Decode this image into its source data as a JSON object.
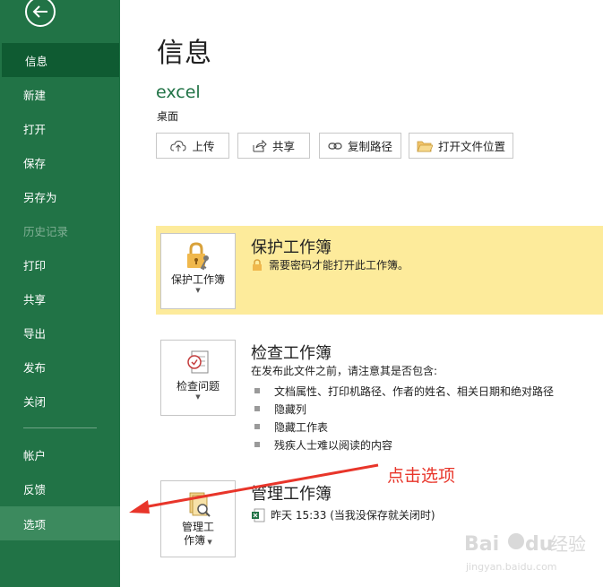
{
  "sidebar": {
    "back_icon": "arrow-left-icon",
    "items": [
      {
        "label": "信息",
        "state": "active"
      },
      {
        "label": "新建",
        "state": "normal"
      },
      {
        "label": "打开",
        "state": "normal"
      },
      {
        "label": "保存",
        "state": "normal"
      },
      {
        "label": "另存为",
        "state": "normal"
      },
      {
        "label": "历史记录",
        "state": "disabled"
      },
      {
        "label": "打印",
        "state": "normal"
      },
      {
        "label": "共享",
        "state": "normal"
      },
      {
        "label": "导出",
        "state": "normal"
      },
      {
        "label": "发布",
        "state": "normal"
      },
      {
        "label": "关闭",
        "state": "normal"
      },
      {
        "label": "帐户",
        "state": "normal"
      },
      {
        "label": "反馈",
        "state": "normal"
      },
      {
        "label": "选项",
        "state": "hover"
      }
    ]
  },
  "main": {
    "title": "信息",
    "file_name": "excel",
    "file_location": "桌面",
    "actions": [
      {
        "label": "上传",
        "icon": "upload-icon"
      },
      {
        "label": "共享",
        "icon": "share-icon"
      },
      {
        "label": "复制路径",
        "icon": "link-icon"
      },
      {
        "label": "打开文件位置",
        "icon": "folder-icon"
      }
    ],
    "protect": {
      "tile_label": "保护工作簿",
      "title": "保护工作簿",
      "desc": "需要密码才能打开此工作簿。"
    },
    "inspect": {
      "tile_label": "检查问题",
      "title": "检查工作簿",
      "desc": "在发布此文件之前，请注意其是否包含:",
      "bullets": [
        "文档属性、打印机路径、作者的姓名、相关日期和绝对路径",
        "隐藏列",
        "隐藏工作表",
        "残疾人士难以阅读的内容"
      ]
    },
    "manage": {
      "tile_label_1": "管理工",
      "tile_label_2": "作簿",
      "title": "管理工作簿",
      "version": "昨天 15:33 (当我没保存就关闭时)"
    }
  },
  "annotation": {
    "text": "点击选项",
    "color": "#e8352a"
  },
  "colors": {
    "sidebar": "#217346",
    "sidebar_active": "#0f5b32",
    "highlight": "#fdeb9b",
    "accent_text": "#217346"
  },
  "watermark": {
    "brand": "Bai",
    "brand_suffix": "du",
    "cn": "经验",
    "url": "jingyan.baidu.com"
  }
}
